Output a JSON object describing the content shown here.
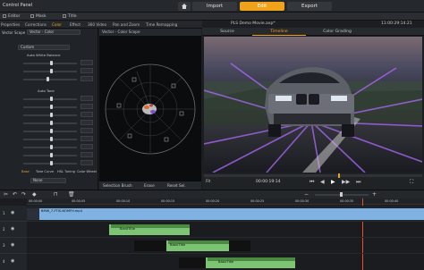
{
  "app": {
    "panel_label": "Control Panel",
    "nav": {
      "import": "Import",
      "edit": "Edit",
      "export": "Export",
      "active": "Edit"
    },
    "row2": {
      "item1": "Editor",
      "item2": "Mask",
      "item3": "Title"
    }
  },
  "effects_tabs": [
    "Properties",
    "Corrections",
    "Color",
    "Effect",
    "360 Video",
    "Pan and Zoom",
    "Time Remapping"
  ],
  "left_panel": {
    "scope_label": "Vector Scope",
    "scope_value": "Vector - Color",
    "auto_wb": "Auto White Balance",
    "preset_value": "Custom",
    "section2": "Auto Tone",
    "tone_tabs": [
      "Base",
      "Tone Curve",
      "HSL Tuning",
      "Color Wheel"
    ],
    "none_value": "None"
  },
  "scope": {
    "title": "Vector - Color Scope",
    "labels": [
      "R",
      "Mg",
      "B",
      "Cy",
      "G",
      "Yl"
    ],
    "footer": {
      "selection": "Selection Brush",
      "erase": "Erase",
      "reset": "Reset Sel."
    }
  },
  "player": {
    "title": "PLS Demo Movie.axp*",
    "timecode_top": "11:00:29:14.21",
    "tabs": [
      "Source",
      "Timeline",
      "Color Grading"
    ],
    "active_tab": "Timeline",
    "fit_label": "Fit",
    "timecode": "00:00:19:14"
  },
  "timeline": {
    "ruler_ticks": [
      "00:00:00",
      "00:00:05",
      "00:00:10",
      "00:00:15",
      "00:00:20",
      "00:00:25",
      "00:00:30",
      "00:00:35",
      "00:00:40"
    ],
    "tracks": [
      {
        "name": "1",
        "clips": [
          {
            "label": "BMW_7-FTIS-NOMFH.mp4",
            "type": "blue"
          }
        ]
      },
      {
        "name": "2",
        "clips": [
          {
            "label": "BandTitle",
            "type": "green"
          }
        ]
      },
      {
        "name": "3",
        "clips": [
          {
            "label": "BasicTitle",
            "type": "green"
          }
        ]
      },
      {
        "name": "4",
        "clips": [
          {
            "label": "BasicTitle",
            "type": "green"
          }
        ]
      }
    ]
  },
  "colors": {
    "accent": "#f0a21a",
    "clip_green": "#7cc473",
    "clip_blue": "#7fb2e2"
  }
}
